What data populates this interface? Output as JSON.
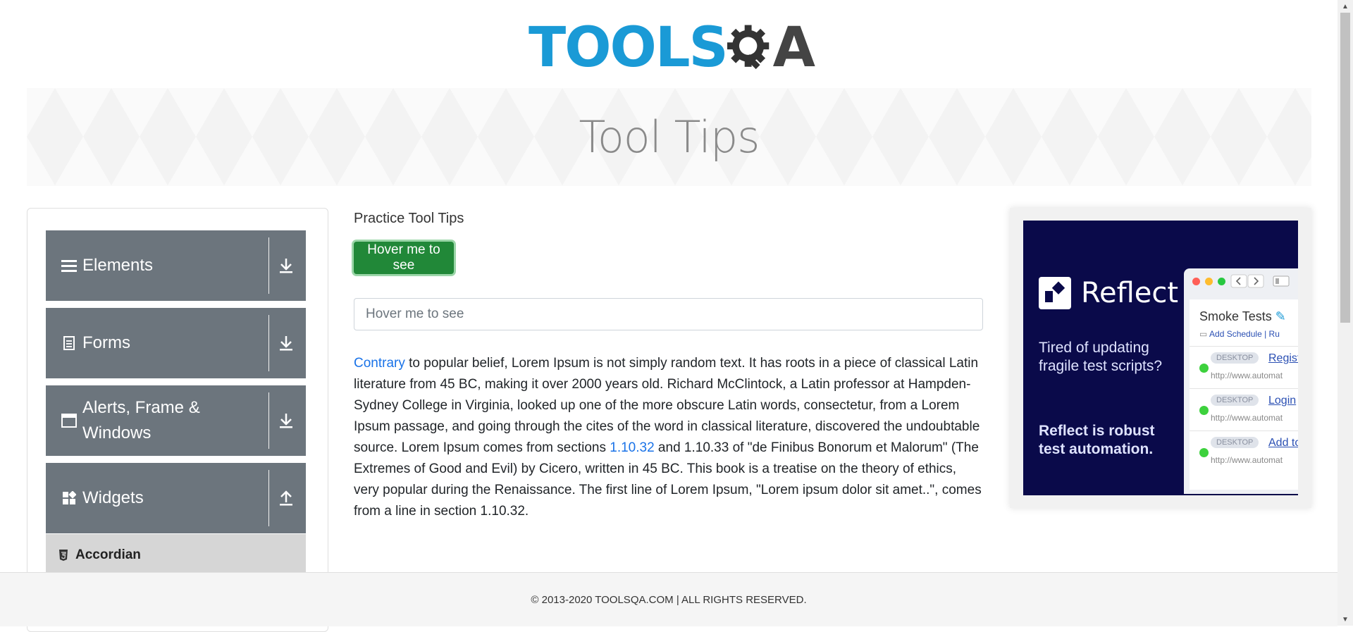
{
  "header": {
    "logo_part_1": "TOOLS",
    "logo_part_2": "A",
    "logo_alt": "TOOLSQA"
  },
  "banner": {
    "title": "Tool Tips"
  },
  "sidebar": {
    "groups": [
      {
        "label": "Elements",
        "icon": "hamburger-icon"
      },
      {
        "label": "Forms",
        "icon": "document-icon"
      },
      {
        "label": "Alerts, Frame & Windows",
        "icon": "window-icon"
      },
      {
        "label": "Widgets",
        "icon": "widgets-icon"
      }
    ],
    "active_item": {
      "label": "Accordian",
      "icon": "html5-icon"
    }
  },
  "main": {
    "heading": "Practice Tool Tips",
    "button_label": "Hover me to see",
    "input_placeholder": "Hover me to see",
    "paragraph": {
      "link_1": "Contrary",
      "text_1": " to popular belief, Lorem Ipsum is not simply random text. It has roots in a piece of classical Latin literature from 45 BC, making it over 2000 years old. Richard McClintock, a Latin professor at Hampden-Sydney College in Virginia, looked up one of the more obscure Latin words, consectetur, from a Lorem Ipsum passage, and going through the cites of the word in classical literature, discovered the undoubtable source. Lorem Ipsum comes from sections ",
      "link_2": "1.10.32",
      "text_2": " and 1.10.33 of \"de Finibus Bonorum et Malorum\" (The Extremes of Good and Evil) by Cicero, written in 45 BC. This book is a treatise on the theory of ethics, very popular during the Renaissance. The first line of Lorem Ipsum, \"Lorem ipsum dolor sit amet..\", comes from a line in section 1.10.32."
    }
  },
  "ad": {
    "brand": "Reflect",
    "tagline_1": "Tired of updating fragile test scripts?",
    "tagline_2": "Reflect is robust test automation.",
    "card_title": "Smoke Tests",
    "card_links": "Add Schedule | Ru",
    "rows": [
      {
        "badge": "DESKTOP",
        "link": "Registr",
        "url": "http://www.automat"
      },
      {
        "badge": "DESKTOP",
        "link": "Login",
        "url": "http://www.automat"
      },
      {
        "badge": "DESKTOP",
        "link": "Add to",
        "url": "http://www.automat"
      }
    ],
    "colors": {
      "background": "#0a0a4a",
      "dot_red": "#ff5f57",
      "dot_yellow": "#febc2e",
      "dot_green": "#28c840"
    }
  },
  "footer": {
    "text": "© 2013-2020 TOOLSQA.COM | ALL RIGHTS RESERVED."
  },
  "colors": {
    "accent_green": "#218838",
    "sidebar_gray": "#6c757d",
    "logo_blue": "#1a9ad6",
    "link_blue": "#1a73e8"
  }
}
